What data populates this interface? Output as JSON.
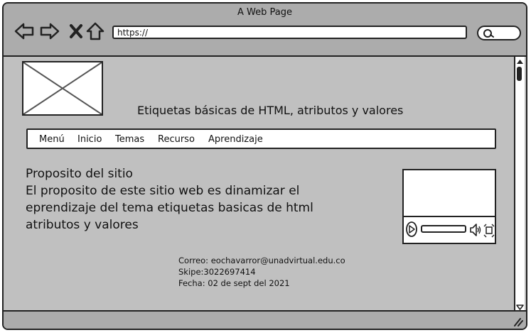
{
  "window": {
    "title": "A Web Page"
  },
  "toolbar": {
    "url": "https://",
    "icons": [
      "back-icon",
      "forward-icon",
      "close-icon",
      "home-icon",
      "search-icon"
    ]
  },
  "header": {
    "heading": "Etiquetas básicas de HTML, atributos y valores",
    "logo_icon": "image-placeholder-icon"
  },
  "menu": {
    "items": [
      {
        "label": "Menú"
      },
      {
        "label": "Inicio"
      },
      {
        "label": "Temas"
      },
      {
        "label": "Recurso"
      },
      {
        "label": "Aprendizaje"
      }
    ]
  },
  "purpose": {
    "title": "Proposito del sitio",
    "lines": [
      "El proposito de este sitio web es dinamizar el",
      "eprendizaje del tema etiquetas basicas de html",
      "atributos y valores"
    ]
  },
  "video": {
    "icons": [
      "play-icon",
      "volume-icon",
      "fullscreen-icon"
    ]
  },
  "contact": {
    "email": "Correo: eochavarror@unadvirtual.edu.co",
    "skype": "Skipe:3022697414",
    "date": "Fecha: 02 de sept del 2021"
  },
  "colors": {
    "chrome": "#acacac",
    "content_bg": "#c0c0c0",
    "outline": "#222222",
    "field_bg": "#ffffff"
  }
}
